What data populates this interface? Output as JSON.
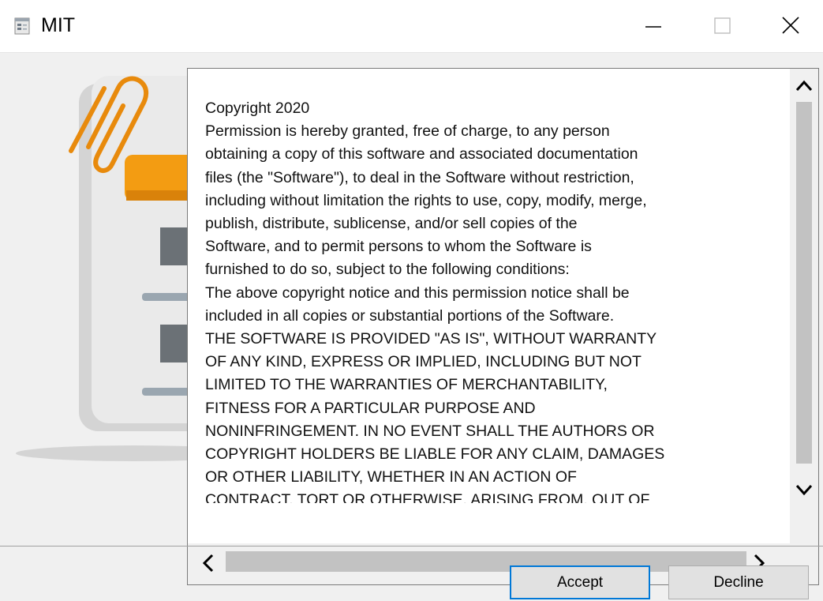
{
  "window": {
    "title": "MIT",
    "icon": "installer-app-icon",
    "controls": [
      "minimize-icon",
      "maximize-icon",
      "close-icon"
    ]
  },
  "illustration": {
    "icon": "document-with-paperclip-illustration",
    "accent_color": "#f39c12"
  },
  "license": {
    "text": "Copyright 2020\nPermission is hereby granted, free of charge, to any person\nobtaining a copy of this software and associated documentation\nfiles (the \"Software\"), to deal in the Software without restriction,\nincluding without limitation the rights to use, copy, modify, merge,\npublish, distribute, sublicense, and/or sell copies of the\nSoftware, and to permit persons to whom the Software is\nfurnished to do so, subject to the following conditions:\nThe above copyright notice and this permission notice shall be\nincluded in all copies or substantial portions of the Software.\nTHE SOFTWARE IS PROVIDED \"AS IS\", WITHOUT WARRANTY\nOF ANY KIND, EXPRESS OR IMPLIED, INCLUDING BUT NOT\nLIMITED TO THE WARRANTIES OF MERCHANTABILITY,\nFITNESS FOR A PARTICULAR PURPOSE AND\nNONINFRINGEMENT. IN NO EVENT SHALL THE AUTHORS OR\nCOPYRIGHT HOLDERS BE LIABLE FOR ANY CLAIM, DAMAGES\nOR OTHER LIABILITY, WHETHER IN AN ACTION OF\nCONTRACT, TORT OR OTHERWISE, ARISING FROM, OUT OF"
  },
  "buttons": {
    "accept_label": "Accept",
    "decline_label": "Decline"
  },
  "colors": {
    "accent_focus": "#0078d7",
    "button_face": "#e1e1e1"
  }
}
